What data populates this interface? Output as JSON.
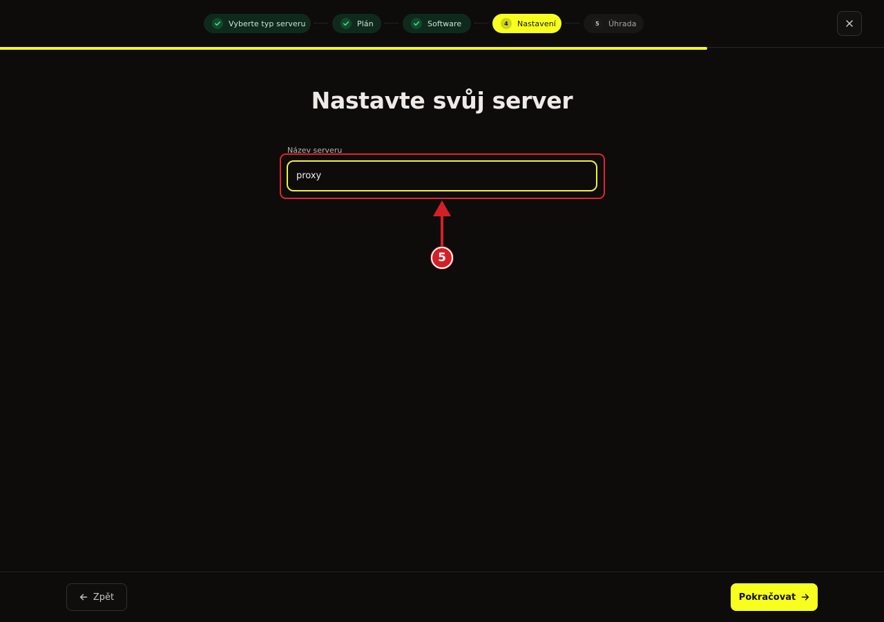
{
  "stepper": {
    "steps": [
      {
        "label": "Vyberte typ serveru",
        "state": "done"
      },
      {
        "label": "Plán",
        "state": "done"
      },
      {
        "label": "Software",
        "state": "done"
      },
      {
        "label": "Nastavení",
        "state": "active",
        "number": "4"
      },
      {
        "label": "Úhrada",
        "state": "pending",
        "number": "5"
      }
    ],
    "progress_fraction": 0.8
  },
  "close_icon": "close-icon",
  "page": {
    "title": "Nastavte svůj server"
  },
  "server_name": {
    "label": "Název serveru",
    "value": "proxy"
  },
  "annotation": {
    "badge": "5",
    "color": "#e2252b"
  },
  "footer": {
    "back_label": "Zpět",
    "next_label": "Pokračovat"
  },
  "colors": {
    "accent": "#f8ff1e",
    "background": "#0d0c0b",
    "done_step": "#0f2a1c"
  }
}
